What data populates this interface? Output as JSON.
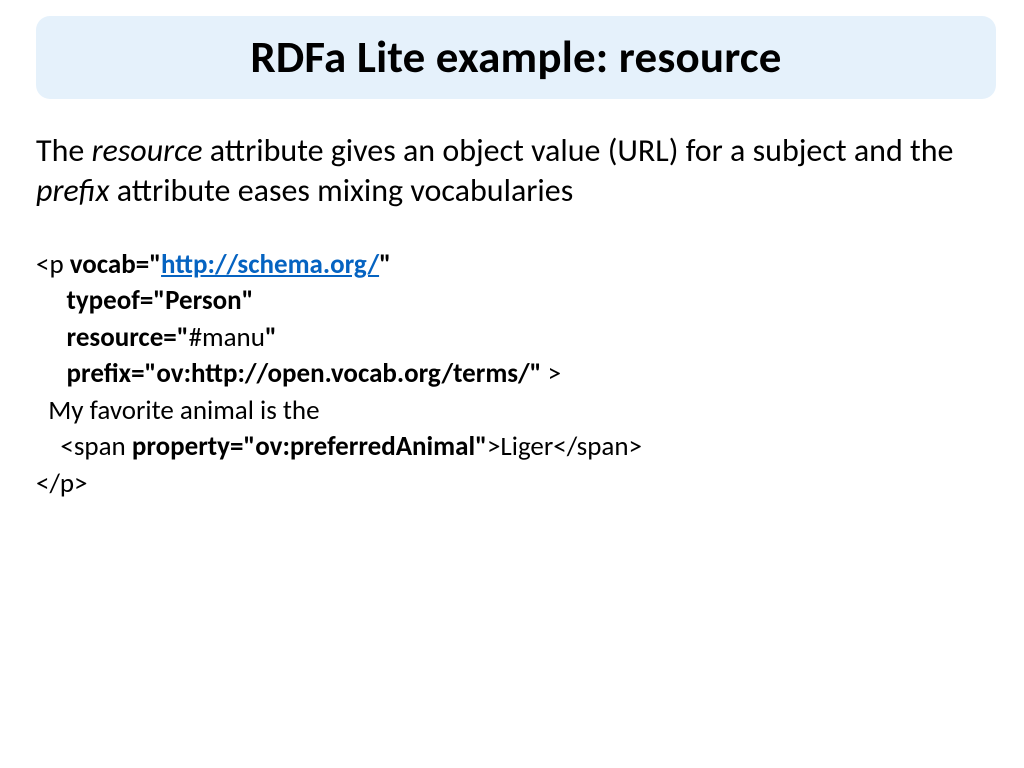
{
  "title": "RDFa Lite example: resource",
  "description": {
    "pre1": "The ",
    "em1": "resource",
    "mid1": " attribute gives an object value (URL) for a subject and the ",
    "em2": "prefix",
    "post1": " attribute eases mixing vocabularies"
  },
  "code": {
    "l1a": "<p ",
    "l1b": "vocab=\"",
    "l1link": "http://schema.org/",
    "l1c": "\"",
    "l2a": "     ",
    "l2b": "typeof=\"Person\"",
    "l3a": "     ",
    "l3b": "resource=\"",
    "l3c": "#manu",
    "l3d": "\"",
    "l4a": "     ",
    "l4b": "prefix=\"ov:http://open.vocab.org/terms/\"",
    "l4c": " >",
    "l5": "  My favorite animal is the",
    "l6a": "    <span ",
    "l6b": "property=\"ov:preferredAnimal\"",
    "l6c": ">Liger</span>",
    "l7": "</p>"
  }
}
